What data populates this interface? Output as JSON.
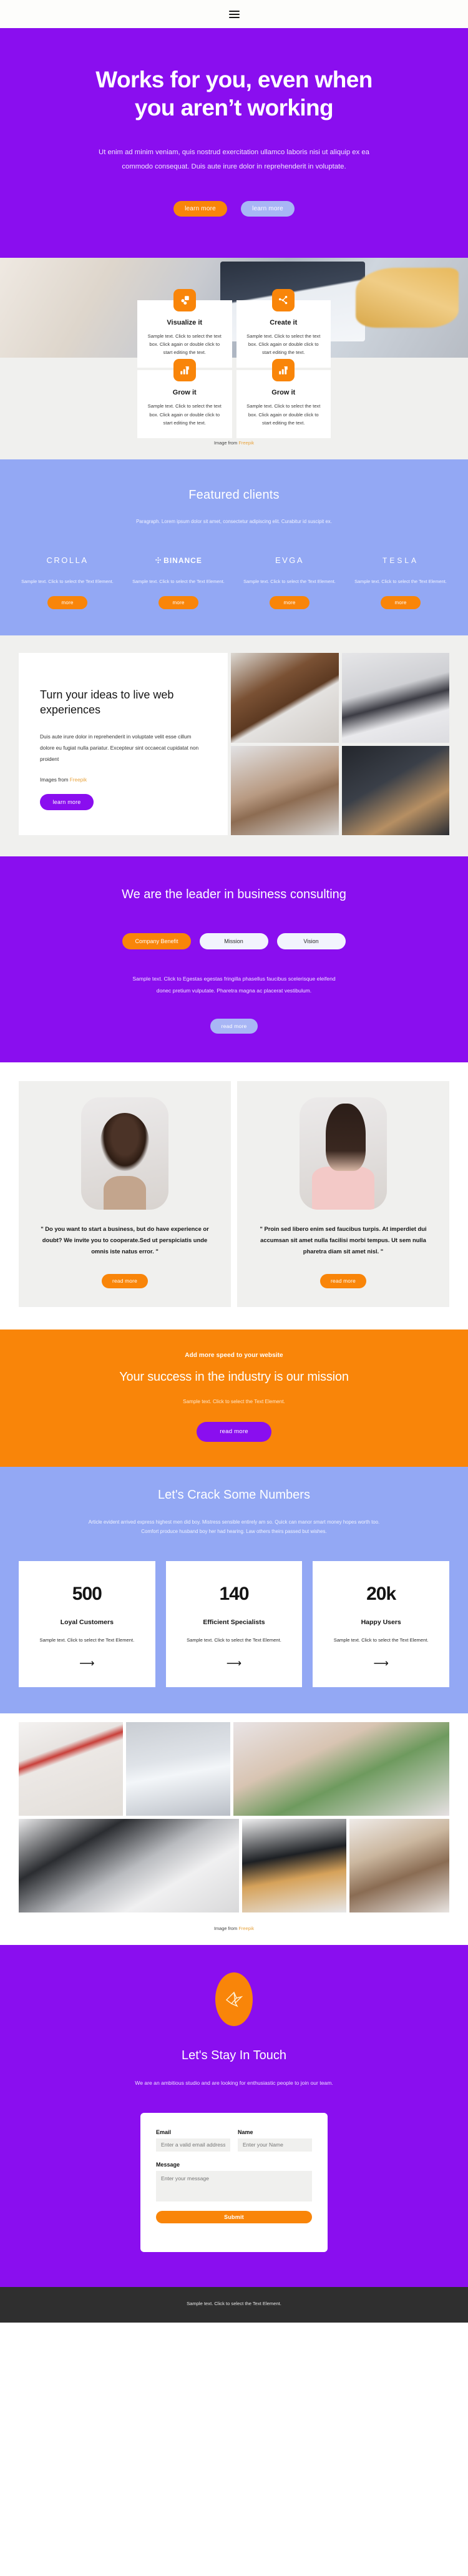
{
  "nav": {
    "menu_icon": "hamburger-icon"
  },
  "hero": {
    "title": "Works for you, even when you aren’t working",
    "paragraph": "Ut enim ad minim veniam, quis nostrud exercitation ullamco laboris nisi ut aliquip ex ea commodo consequat. Duis aute irure dolor in reprehenderit in voluptate.",
    "primary_btn": "learn more",
    "secondary_btn": "learn more"
  },
  "features": {
    "cards": [
      {
        "icon": "layers-icon",
        "title": "Visualize it",
        "text": "Sample text. Click to select the text box. Click again or double click to start editing the text."
      },
      {
        "icon": "network-icon",
        "title": "Create it",
        "text": "Sample text. Click to select the text box. Click again or double click to start editing the text."
      },
      {
        "icon": "bar-chart-growth-icon",
        "title": "Grow it",
        "text": "Sample text. Click to select the text box. Click again or double click to start editing the text."
      },
      {
        "icon": "bar-chart-growth-icon",
        "title": "Grow it",
        "text": "Sample text. Click to select the text box. Click again or double click to start editing the text."
      }
    ],
    "credit_prefix": "Image from ",
    "credit_link": "Freepik"
  },
  "clients": {
    "title": "Featured clients",
    "subtitle": "Paragraph. Lorem ipsum dolor sit amet, consectetur adipiscing elit. Curabitur id suscipit ex.",
    "items": [
      {
        "logo": "CROLLA",
        "logo_style": "plain",
        "text": "Sample text. Click to select the Text Element.",
        "button": "more"
      },
      {
        "logo": "BINANCE",
        "logo_style": "bold",
        "text": "Sample text. Click to select the Text Element.",
        "button": "more"
      },
      {
        "logo": "EVGA",
        "logo_style": "plain",
        "text": "Sample text. Click to select the Text Element.",
        "button": "more"
      },
      {
        "logo": "TESLA",
        "logo_style": "plain",
        "text": "Sample text. Click to select the Text Element.",
        "button": "more"
      }
    ]
  },
  "ideas": {
    "title": "Turn your ideas to live web experiences",
    "body": "Duis aute irure dolor in reprehenderit in voluptate velit esse cillum dolore eu fugiat nulla pariatur. Excepteur sint occaecat cupidatat non proident",
    "credit_prefix": "Images from ",
    "credit_link": "Freepik",
    "button": "learn more"
  },
  "leader": {
    "title": "We are the leader in business consulting",
    "tabs": [
      {
        "label": "Company Benefit",
        "active": true
      },
      {
        "label": "Mission",
        "active": false
      },
      {
        "label": "Vision",
        "active": false
      }
    ],
    "body": "Sample text. Click to Egestas egestas fringilla phasellus faucibus scelerisque eleifend donec pretium vulputate. Pharetra magna ac placerat vestibulum.",
    "button": "read more"
  },
  "testimonials": [
    {
      "avatar": "avatar-woman-curly-hair",
      "quote": "\" Do you want to start a business, but do have experience or doubt? We invite you to cooperate.Sed ut perspiciatis unde omnis iste natus error. \"",
      "button": "read more"
    },
    {
      "avatar": "avatar-woman-long-hair",
      "quote": "\" Proin sed libero enim sed faucibus turpis. At imperdiet dui accumsan sit amet nulla facilisi morbi tempus. Ut sem nulla pharetra diam sit amet nisl. \"",
      "button": "read more"
    }
  ],
  "cta": {
    "kicker": "Add more speed to your website",
    "title": "Your success in the industry is our mission",
    "body": "Sample text. Click to select the Text Element.",
    "button": "read more"
  },
  "numbers": {
    "title": "Let's Crack Some Numbers",
    "subtitle": "Article evident arrived express highest men did boy. Mistress sensible entirely am so. Quick can manor smart money hopes worth too. Comfort produce husband boy her had hearing. Law others theirs passed but wishes.",
    "stats": [
      {
        "value": "500",
        "label": "Loyal Customers",
        "text": "Sample text. Click to select the Text Element.",
        "arrow": "arrow-right-icon"
      },
      {
        "value": "140",
        "label": "Efficient Specialists",
        "text": "Sample text. Click to select the Text Element.",
        "arrow": "arrow-right-icon"
      },
      {
        "value": "20k",
        "label": "Happy Users",
        "text": "Sample text. Click to select the Text Element.",
        "arrow": "arrow-right-icon"
      }
    ]
  },
  "gallery": {
    "credit_prefix": "Image from ",
    "credit_link": "Freepik"
  },
  "contact": {
    "logo_icon": "origami-bird-icon",
    "title": "Let's Stay In Touch",
    "subtitle": "We are an ambitious studio and are looking for enthusiastic people to join our team.",
    "email_label": "Email",
    "email_placeholder": "Enter a valid email address",
    "name_label": "Name",
    "name_placeholder": "Enter your Name",
    "message_label": "Message",
    "message_placeholder": "Enter your message",
    "submit": "Submit"
  },
  "footer": {
    "text": "Sample text. Click to select the Text Element."
  },
  "colors": {
    "purple": "#8A0EEF",
    "orange": "#F98509",
    "lilac": "#A8B6F5",
    "periwinkle": "#93A8F4",
    "light_gray": "#f0f0ee",
    "footer_dark": "#2f2f2f",
    "link_gold": "#E8A33D"
  }
}
